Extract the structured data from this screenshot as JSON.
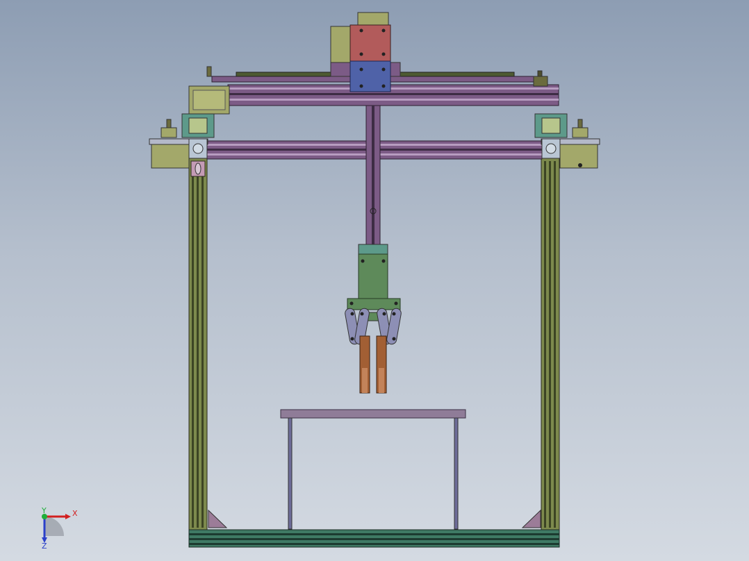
{
  "viewport": {
    "background_top": "#8d9db3",
    "background_bottom": "#d4dae2"
  },
  "model": {
    "colors": {
      "frame_profile": "#6b7a3f",
      "frame_highlight": "#a8b27a",
      "motor_body": "#a3a86a",
      "rail_purple": "#7c5b86",
      "rail_light": "#b79cc0",
      "carriage_red": "#b25b5b",
      "carriage_blue": "#4f62a8",
      "bracket_teal": "#5d9a8a",
      "gripper_green": "#5e8a5a",
      "finger_brown": "#a25f34",
      "link_gray": "#8d8fb5",
      "base_teal": "#3f7a64",
      "table_top": "#8f7c98",
      "table_leg": "#6d6c98"
    }
  },
  "triad": {
    "x_label": "X",
    "y_label": "Y",
    "z_label": "Z",
    "x_color": "#d22020",
    "y_color": "#1fae3a",
    "z_color": "#2a3fc9"
  }
}
